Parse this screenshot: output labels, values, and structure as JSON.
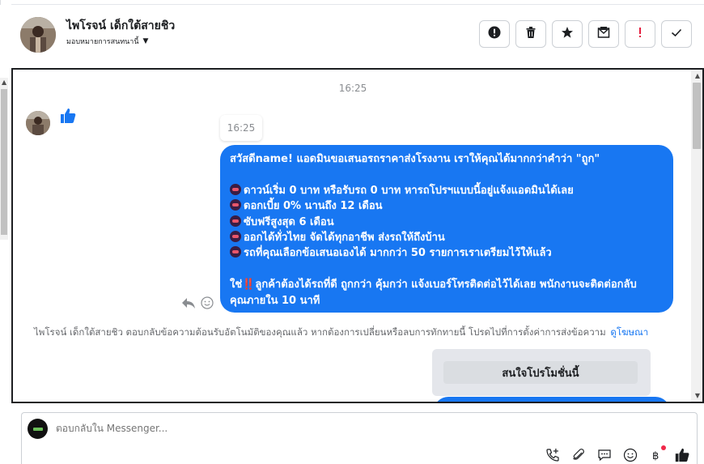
{
  "header": {
    "contact_name": "ไพโรจน์ เด็กใต้สายชิว",
    "assign_label": "มอบหมายการสนทนานี้",
    "actions": [
      {
        "icon": "alert-circle-icon",
        "label": "report"
      },
      {
        "icon": "trash-icon",
        "label": "delete"
      },
      {
        "icon": "star-icon",
        "label": "star"
      },
      {
        "icon": "mail-unread-icon",
        "label": "mark unread"
      },
      {
        "icon": "priority-icon",
        "label": "priority"
      },
      {
        "icon": "check-icon",
        "label": "done"
      }
    ]
  },
  "conversation": {
    "timestamp_center": "16:25",
    "timestamp_badge": "16:25",
    "incoming_reaction": "thumbs-up",
    "bubble": {
      "line1": "สวัสดีname! แอดมินขอเสนอรถราคาส่งโรงงาน เราให้คุณได้มากกว่าคำว่า \"ถูก\"",
      "line2": "ดาวน์เริ่ม 0 บาท หรือรับรถ 0 บาท หารถโปรฯแบบนี้อยู่แจ้งแอดมินได้เลย",
      "line3": "ดอกเบี้ย 0% นานถึง 12 เดือน",
      "line4": "ซับฟรีสูงสุด 6 เดือน",
      "line5": "ออกได้ทั่วไทย จัดได้ทุกอาชีพ ส่งรถให้ถึงบ้าน",
      "line6": "รถที่คุณเลือกข้อเสนอเองได้ มากกว่า 50 รายการเราเตรียมไว้ให้แล้ว",
      "line7_pre": "ใช่",
      "line7_bang": "‼️",
      "line7_post": "ลูกค้าต้องได้รถที่ดี ถูกกว่า คุ้มกว่า แจ้งเบอร์โทรติดต่อไว้ได้เลย พนักงานจะติดต่อกลับ",
      "line8": "คุณภายใน 10 นาที"
    },
    "system_note": "ไพโรจน์ เด็กใต้สายชิว ตอบกลับข้อความต้อนรับอัตโนมัติของคุณแล้ว หากต้องการเปลี่ยนหรือลบการทักทายนี้ โปรดไปที่การตั้งค่าการส่งข้อความ",
    "system_link": "ดูโฆษณา",
    "promo_button": "สนใจโปรโมชั่นนี้"
  },
  "composer": {
    "placeholder": "ตอบกลับใน Messenger...",
    "tools": [
      "phone-plus-icon",
      "paperclip-icon",
      "saved-reply-icon",
      "emoji-icon",
      "baht-icon",
      "thumbs-up-icon"
    ]
  },
  "colors": {
    "bubble": "#1877f2",
    "link": "#1877f2",
    "badge_dot": "#f02849"
  }
}
